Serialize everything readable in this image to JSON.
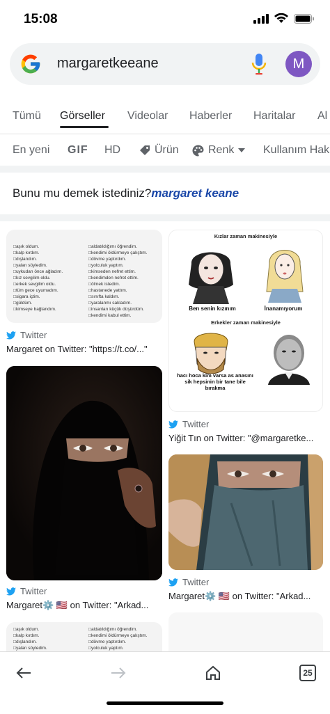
{
  "status": {
    "time": "15:08"
  },
  "search": {
    "query": "margaretkeeane",
    "avatar_letter": "M"
  },
  "tabs": [
    {
      "label": "Tümü"
    },
    {
      "label": "Görseller"
    },
    {
      "label": "Videolar"
    },
    {
      "label": "Haberler"
    },
    {
      "label": "Haritalar"
    },
    {
      "label": "Al"
    }
  ],
  "filters": [
    {
      "label": "En yeni"
    },
    {
      "label": "GIF"
    },
    {
      "label": "HD"
    },
    {
      "label": "Ürün"
    },
    {
      "label": "Renk"
    },
    {
      "label": "Kullanım Hak"
    }
  ],
  "suggestion": {
    "prefix": "Bunu mu demek istediniz?",
    "link": "margaret keane"
  },
  "results": [
    {
      "source": "Twitter",
      "caption": "Margaret on Twitter: \"https://t.co/...\""
    },
    {
      "source": "Twitter",
      "caption": "Yiğit Tın on Twitter: \"@margaretke..."
    },
    {
      "source": "Twitter",
      "caption": "Margaret⚙️ 🇺🇸 on Twitter: \"Arkad..."
    },
    {
      "source": "Twitter",
      "caption": "Margaret⚙️ 🇺🇸 on Twitter: \"Arkad..."
    }
  ],
  "checklist": {
    "left": [
      "aşık oldum.",
      "kalp kırdım.",
      "dışlandım.",
      "yalan söyledim.",
      "uykudan önce ağladım.",
      "kız sevgilim oldu.",
      "erkek sevgilim oldu.",
      "tüm gece uyumadım.",
      "sigara içtim.",
      "güldüm.",
      "kimseye bağlandım."
    ],
    "right": [
      "aldatıldığımı öğrendim.",
      "kendimi öldürmeye çalıştım.",
      "dövme yaptırdım.",
      "yolculuk yaptım.",
      "kimseden nefret ettim.",
      "kendimden nefret ettim.",
      "ölmek istedim.",
      "hastanede yattım.",
      "sınıfta kaldım.",
      "yaralanmı sakladım.",
      "insanları küçük düşürdüm.",
      "kendimi kabul ettim."
    ]
  },
  "meme": {
    "title1": "Kızlar zaman makinesiyle",
    "cap1": "Ben senin kızınım",
    "cap2": "İnanamıyorum",
    "title2": "Erkekler zaman makinesiyle",
    "cap3": "hacı hoca kim varsa as anasını sik hepsinin bir tane bile bırakma"
  },
  "tab_count": "25",
  "colors": {
    "accent_link": "#1a47a8",
    "avatar": "#7e57c2",
    "twitter": "#1da1f2"
  }
}
